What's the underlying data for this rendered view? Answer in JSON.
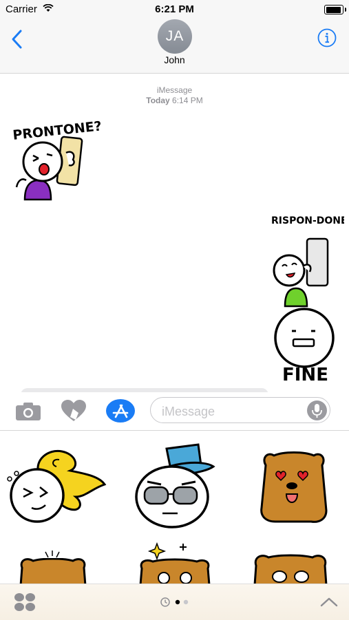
{
  "status_bar": {
    "carrier": "Carrier",
    "time": "6:21 PM"
  },
  "header": {
    "avatar_initials": "JA",
    "contact_name": "John"
  },
  "conversation": {
    "service": "iMessage",
    "day": "Today",
    "time": "6:14 PM",
    "stickers": [
      {
        "caption": "PRONTONE?"
      },
      {
        "caption": "RISPON-DONE!"
      },
      {
        "caption": "FINE"
      }
    ]
  },
  "composer": {
    "placeholder": "iMessage"
  },
  "colors": {
    "accent": "#1a7cf5",
    "bar": "#f7f7f7",
    "sticker_brown": "#c9862b",
    "sticker_yellow": "#f5d31f",
    "sticker_blue": "#4aa8d8",
    "purple": "#8a2fc0",
    "green": "#6fd12c"
  },
  "icons": [
    "back-chevron-icon",
    "info-icon",
    "camera-icon",
    "digital-touch-icon",
    "app-store-icon",
    "microphone-icon",
    "app-drawer-icon",
    "recents-clock-icon",
    "chevron-up-icon"
  ]
}
